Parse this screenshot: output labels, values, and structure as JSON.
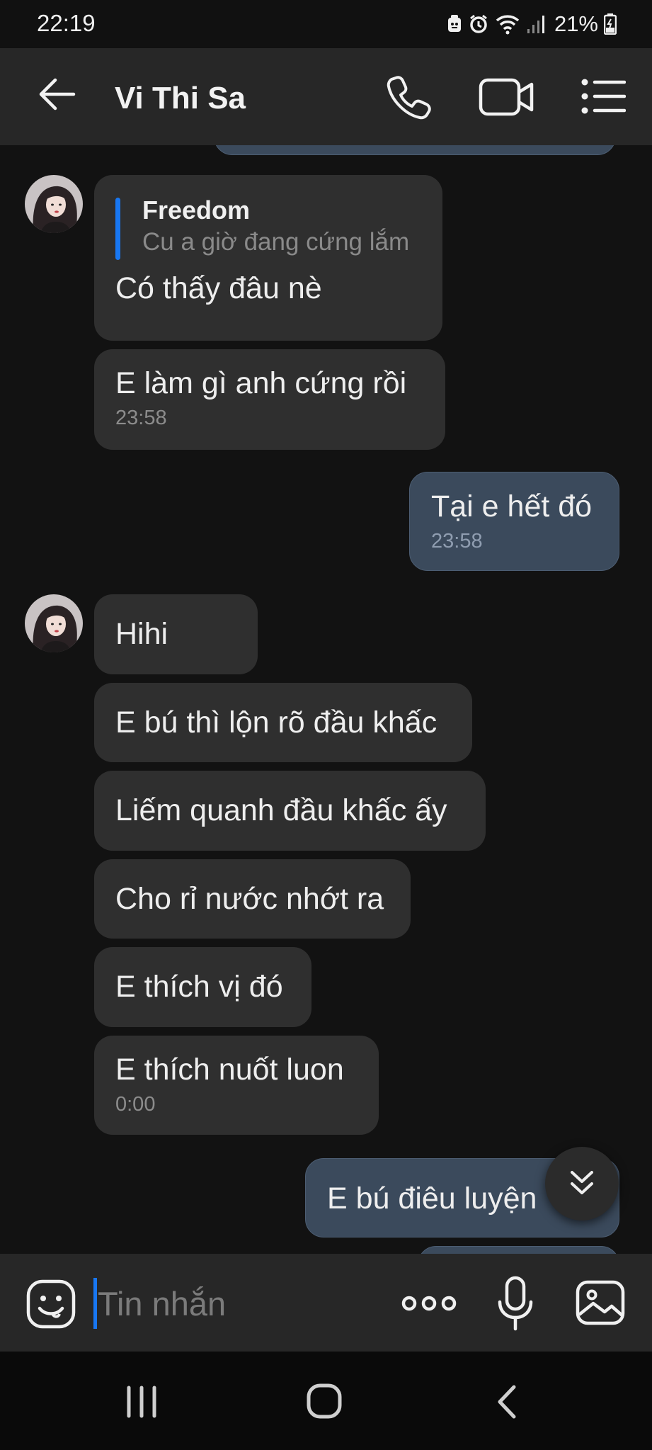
{
  "status_bar": {
    "time": "22:19",
    "battery": "21%"
  },
  "header": {
    "contact_name": "Vi Thi Sa",
    "icons": [
      "back-arrow-icon",
      "phone-icon",
      "video-camera-icon",
      "menu-list-icon"
    ]
  },
  "messages": [
    {
      "side": "in",
      "quote_author": "Freedom",
      "quote_text": "Cu a giờ đang cứng lắm",
      "text": "Có thấy đâu nè"
    },
    {
      "side": "in",
      "text": "E làm gì anh cứng rồi",
      "time": "23:58"
    },
    {
      "side": "out",
      "text": "Tại e hết đó",
      "time": "23:58"
    },
    {
      "side": "in",
      "text": "Hihi"
    },
    {
      "side": "in",
      "text": "E bú thì lộn rõ đầu khấc"
    },
    {
      "side": "in",
      "text": "Liếm quanh đầu khấc ấy"
    },
    {
      "side": "in",
      "text": "Cho rỉ nước nhớt ra"
    },
    {
      "side": "in",
      "text": "E thích vị đó"
    },
    {
      "side": "in",
      "text": "E thích nuốt luon",
      "time": "0:00"
    },
    {
      "side": "out",
      "text": "E bú điêu luyện"
    }
  ],
  "composer": {
    "placeholder": "Tin nhắn",
    "icons": [
      "emoji-icon",
      "more-options-icon",
      "microphone-icon",
      "gallery-icon"
    ]
  },
  "colors": {
    "background": "#121212",
    "header": "#272727",
    "incoming_bubble": "#2f2f2f",
    "outgoing_bubble": "#3b4a5c",
    "accent": "#1877f2"
  }
}
